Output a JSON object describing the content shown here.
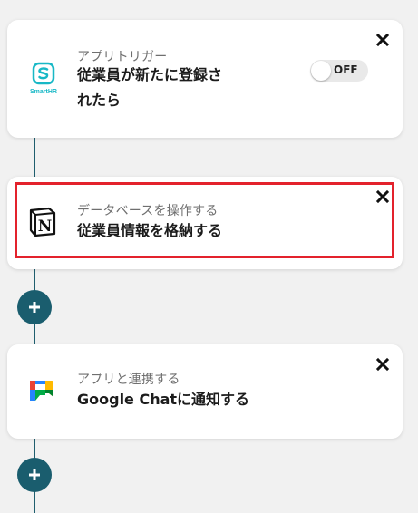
{
  "steps": [
    {
      "app": "SmartHR",
      "subtitle": "アプリトリガー",
      "title_line1": "従業員が新たに登録さ",
      "title_line2": "れたら",
      "toggle_label": "OFF",
      "logo_text": "SmartHR"
    },
    {
      "app": "Notion",
      "subtitle": "データベースを操作する",
      "title": "従業員情報を格納する",
      "logo_text": "N"
    },
    {
      "app": "Google Chat",
      "subtitle": "アプリと連携する",
      "title": "Google Chatに通知する"
    }
  ],
  "colors": {
    "connector": "#1f5e6e",
    "add_button": "#1a5d6e",
    "highlight": "#e3222c",
    "smarthr": "#18b8c6"
  }
}
